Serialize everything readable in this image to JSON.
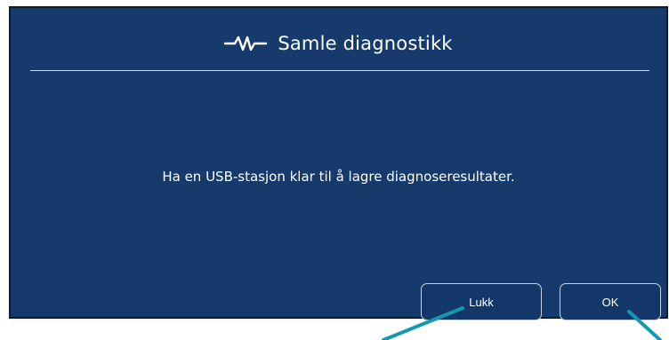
{
  "dialog": {
    "title": "Samle diagnostikk",
    "title_icon": "pulse-icon",
    "message": "Ha en USB-stasjon klar til å lagre diagnoseresultater.",
    "buttons": {
      "close_label": "Lukk",
      "ok_label": "OK"
    }
  },
  "colors": {
    "dialog_background": "#163a6b",
    "dialog_border": "#0b1a33",
    "text": "#ffffff",
    "button_border": "#c7d2e4",
    "divider": "#d7dde8",
    "pointer_line": "#1497b0"
  }
}
